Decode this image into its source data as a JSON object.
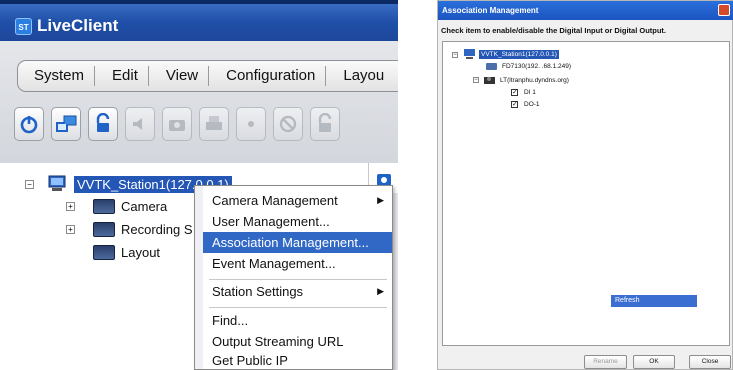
{
  "app": {
    "title": "LiveClient",
    "logo_text": "ST"
  },
  "menu": [
    "System",
    "Edit",
    "View",
    "Configuration",
    "Layou"
  ],
  "toolbar_icons": [
    "power-icon",
    "monitor-icon",
    "lock-icon",
    "speaker-icon",
    "camera-icon",
    "printer-icon",
    "record-icon",
    "disabled-icon",
    "lock2-icon"
  ],
  "tree": {
    "station": "VVTK_Station1(127.0.0.1)",
    "children": [
      "Camera",
      "Recording S",
      "Layout"
    ]
  },
  "context_menu": {
    "items": [
      {
        "label": "Camera Management",
        "submenu": true
      },
      {
        "label": "User Management...",
        "submenu": false
      },
      {
        "label": "Association Management...",
        "submenu": false,
        "selected": true
      },
      {
        "label": "Event Management...",
        "submenu": false
      },
      {
        "label": "Station Settings",
        "submenu": true
      },
      {
        "label": "Find...",
        "submenu": false
      },
      {
        "label": "Output Streaming URL",
        "submenu": false
      },
      {
        "label": "Get Public IP",
        "submenu": false
      }
    ]
  },
  "dialog": {
    "title": "Association Management",
    "instruction": "Check item to enable/disable the Digital Input or Digital Output.",
    "station": "VVTK_Station1(127.0.0.1)",
    "device1": "FD7130(192.  .68.1.249)",
    "device2": "LT(ltranphu.dyndns.org)",
    "di": "DI 1",
    "do": "DO-1",
    "refresh_label": "Refresh",
    "buttons": {
      "rename": "Rename",
      "ok": "OK",
      "close": "Close"
    }
  },
  "colors": {
    "titlebar": "#1f4fa8",
    "selection": "#3168c6"
  }
}
